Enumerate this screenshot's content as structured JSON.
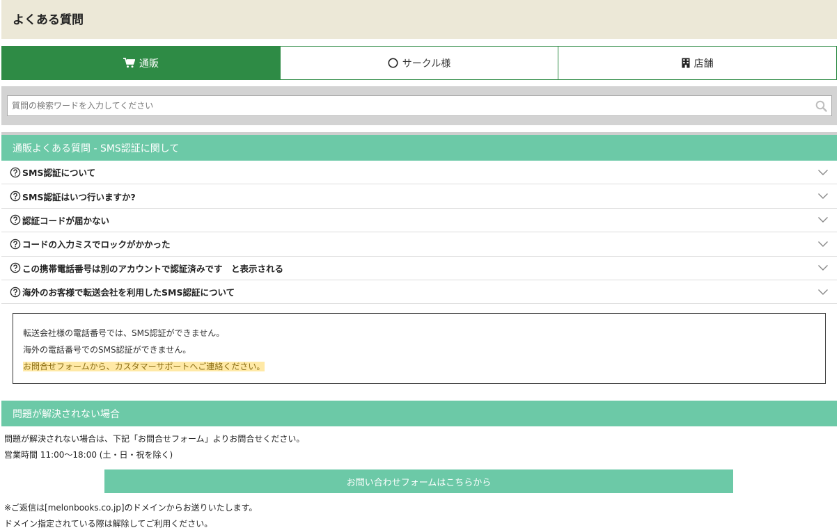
{
  "header": {
    "title": "よくある質問"
  },
  "tabs": [
    {
      "label": "通販",
      "icon": "cart-icon",
      "active": true
    },
    {
      "label": "サークル様",
      "icon": "circle-icon",
      "active": false
    },
    {
      "label": "店舗",
      "icon": "building-icon",
      "active": false
    }
  ],
  "search": {
    "placeholder": "質問の検索ワードを入力してください",
    "value": ""
  },
  "faq_section": {
    "title": "通販よくある質問 - SMS認証に関して",
    "items": [
      "SMS認証について",
      "SMS認証はいつ行いますか?",
      "認証コードが届かない",
      "コードの入力ミスでロックがかかった",
      "この携帯電話番号は別のアカウントで認証済みです　と表示される",
      "海外のお客様で転送会社を利用したSMS認証について"
    ]
  },
  "answer": {
    "line1": "転送会社様の電話番号では、SMS認証ができません。",
    "line2": "海外の電話番号でのSMS認証ができません。",
    "line3": "お問合せフォームから、カスタマーサポートへご連絡ください。"
  },
  "contact_section": {
    "title": "問題が解決されない場合",
    "text1": "問題が解決されない場合は、下記「お問合せフォーム」よりお問合せください。",
    "text2": "営業時間 11:00～18:00 (土・日・祝を除く)",
    "button": "お問い合わせフォームはこちらから",
    "note1": "※ご返信は[melonbooks.co.jp]のドメインからお送りいたします。",
    "note2": "ドメイン指定されている際は解除してご利用ください。"
  },
  "colors": {
    "tab_active": "#2e8b45",
    "section_head": "#6cc9a7",
    "header_bg": "#ece8d7",
    "highlight": "#ffe9a6"
  }
}
